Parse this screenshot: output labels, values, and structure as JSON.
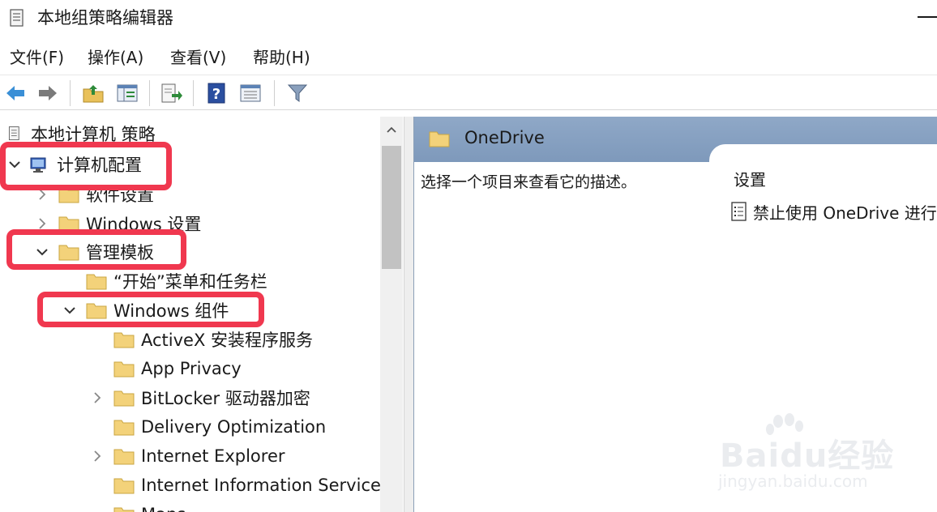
{
  "window": {
    "title": "本地组策略编辑器"
  },
  "menu": [
    {
      "label": "文件(F)"
    },
    {
      "label": "操作(A)"
    },
    {
      "label": "查看(V)"
    },
    {
      "label": "帮助(H)"
    }
  ],
  "toolbar": {
    "icons": [
      "back-arrow-icon",
      "forward-arrow-icon",
      "up-folder-icon",
      "show-hide-tree-icon",
      "export-list-icon",
      "help-icon",
      "properties-icon",
      "filter-icon"
    ]
  },
  "tree": {
    "root": "本地计算机 策略",
    "items": [
      {
        "label": "计算机配置",
        "expanded": true
      },
      {
        "label": "软件设置",
        "expanded": false
      },
      {
        "label": "Windows 设置",
        "expanded": false
      },
      {
        "label": "管理模板",
        "expanded": true
      },
      {
        "label": "“开始”菜单和任务栏"
      },
      {
        "label": "Windows 组件",
        "expanded": true
      },
      {
        "label": "ActiveX 安装程序服务"
      },
      {
        "label": "App Privacy"
      },
      {
        "label": "BitLocker 驱动器加密",
        "expanded": false
      },
      {
        "label": "Delivery Optimization"
      },
      {
        "label": "Internet Explorer",
        "expanded": false
      },
      {
        "label": "Internet Information Service"
      },
      {
        "label": "Maps"
      }
    ]
  },
  "right_pane": {
    "title": "OneDrive",
    "description": "选择一个项目来查看它的描述。",
    "column_header": "设置",
    "settings": [
      {
        "label": "禁止使用 OneDrive 进行"
      }
    ]
  },
  "colors": {
    "highlight": "#f0384f",
    "folder": "#f3d27a",
    "header": "#8fa8c7"
  },
  "watermark": {
    "brand": "Baidu经验",
    "url": "jingyan.baidu.com"
  }
}
